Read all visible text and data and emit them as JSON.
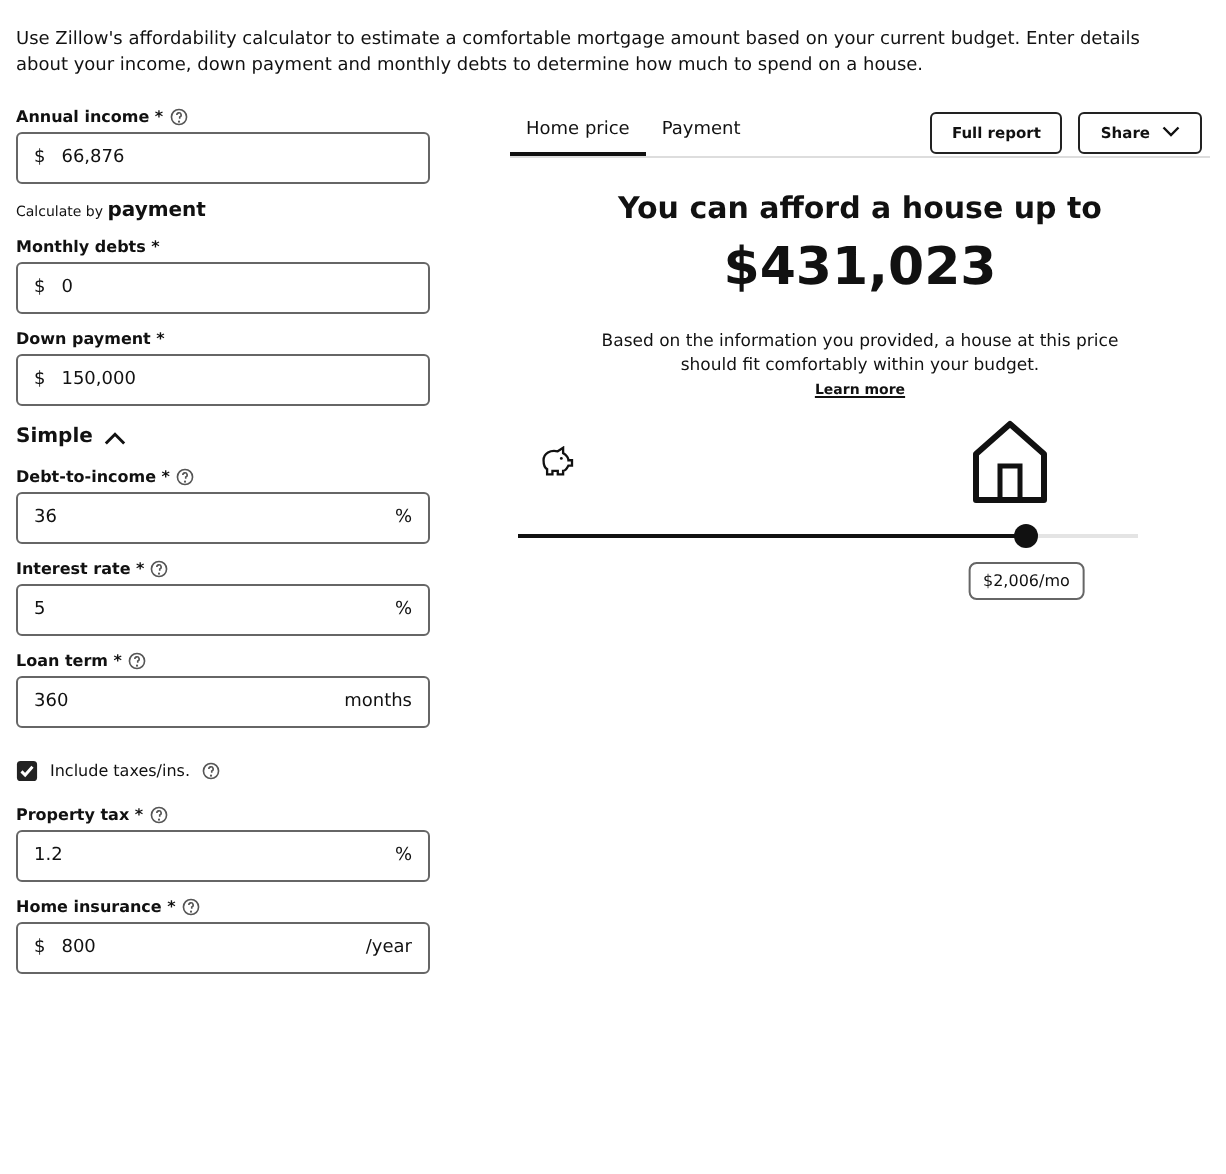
{
  "intro": "Use Zillow's affordability calculator to estimate a comfortable mortgage amount based on your current budget. Enter details about your income, down payment and monthly debts to determine how much to spend on a house.",
  "form": [
    {
      "kind": "field",
      "label": "Annual income *",
      "help": true,
      "prefix": "$",
      "value": "66,876"
    },
    {
      "kind": "link",
      "text": "Calculate by **payment**"
    },
    {
      "kind": "field",
      "label": "Monthly debts *",
      "help": false,
      "prefix": "$",
      "value": "0"
    },
    {
      "kind": "field",
      "label": "Down payment *",
      "help": false,
      "prefix": "$",
      "value": "150,000"
    },
    {
      "kind": "toggle",
      "text": "Simple",
      "expanded": true
    },
    {
      "kind": "field",
      "label": "Debt-to-income *",
      "help": true,
      "value": "36",
      "suffix": "%"
    },
    {
      "kind": "field",
      "label": "Interest rate *",
      "help": true,
      "value": "5",
      "suffix": "%"
    },
    {
      "kind": "field",
      "label": "Loan term *",
      "help": true,
      "value": "360",
      "suffix": "months"
    },
    {
      "kind": "checkbox",
      "text": "Include taxes/ins.",
      "checked": true,
      "help": true
    },
    {
      "kind": "field",
      "label": "Property tax *",
      "help": true,
      "value": "1.2",
      "suffix": "%"
    },
    {
      "kind": "field",
      "label": "Home insurance *",
      "help": true,
      "prefix": "$",
      "value": "800",
      "suffix": "/year"
    }
  ],
  "tabs": [
    {
      "label": "Home price",
      "selected": true
    },
    {
      "label": "Payment",
      "selected": false
    }
  ],
  "buttons": [
    {
      "label": "Full report",
      "dropdown": false
    },
    {
      "label": "Share",
      "dropdown": true
    }
  ],
  "result": {
    "heading": "You can afford a house up to",
    "amount": "$431,023",
    "note": "Based on the information you provided, a house at this price should fit comfortably within your budget.",
    "link": "Learn more"
  },
  "slider": {
    "level": 0.82,
    "reading": "$2,006/mo"
  }
}
